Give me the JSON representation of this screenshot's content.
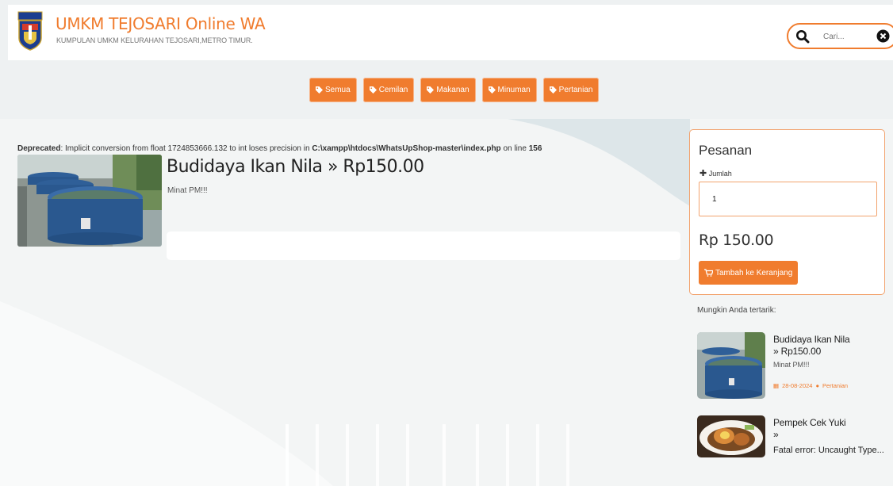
{
  "header": {
    "title": "UMKM TEJOSARI Online WA",
    "subtitle": "KUMPULAN UMKM KELURAHAN TEJOSARI,METRO TIMUR.",
    "logo_text": "METRO"
  },
  "search": {
    "placeholder": "Cari..."
  },
  "categories": [
    "Semua",
    "Cemilan",
    "Makanan",
    "Minuman",
    "Pertanian"
  ],
  "notice": {
    "label": "Deprecated",
    "text1": ": Implicit conversion from float 1724853666.132 to int loses precision in ",
    "path": "C:\\xampp\\htdocs\\WhatsUpShop-master\\index.php",
    "text2": " on line ",
    "line": "156"
  },
  "product": {
    "title": "Budidaya Ikan Nila » Rp150.00",
    "description": "Minat PM!!!"
  },
  "order": {
    "title": "Pesanan",
    "qty_label": "Jumlah",
    "qty_value": "1",
    "price": "Rp 150.00",
    "button": "Tambah ke Keranjang"
  },
  "related": {
    "label": "Mungkin Anda tertarik:",
    "items": [
      {
        "title_line1": "Budidaya Ikan Nila",
        "title_line2": "» Rp150.00",
        "desc": "Minat PM!!!",
        "date": "28-08-2024",
        "category": "Pertanian"
      },
      {
        "title_line1": "Pempek Cek Yuki",
        "title_line2": "»",
        "error": "Fatal error: Uncaught Type..."
      }
    ]
  },
  "colors": {
    "accent": "#f07c2e",
    "accent_light": "#f2a36e",
    "background": "#eef1f2"
  }
}
